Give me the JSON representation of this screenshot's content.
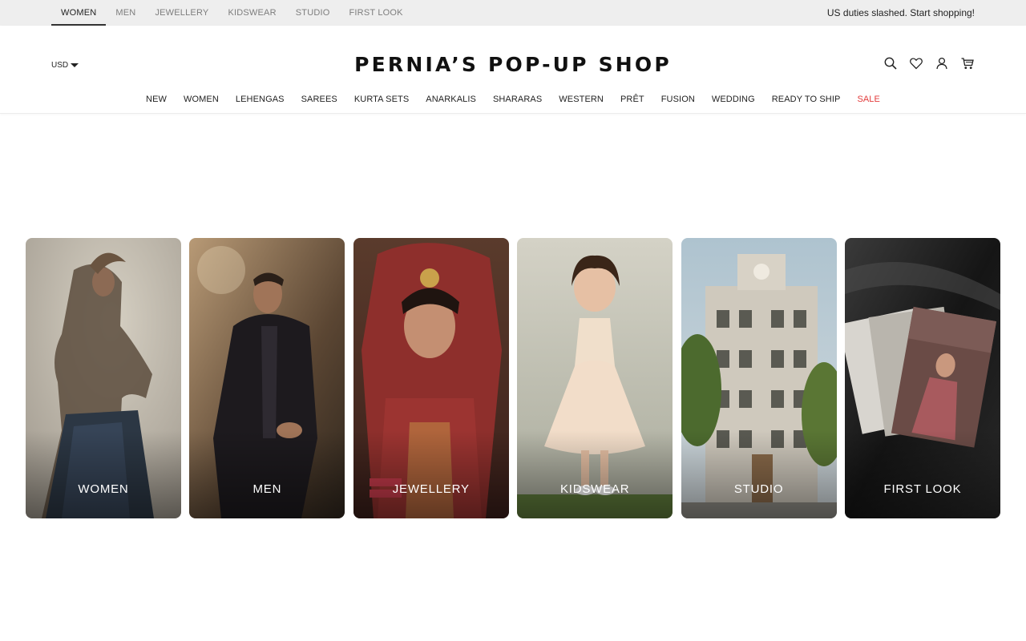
{
  "topbar": {
    "tabs": [
      {
        "label": "WOMEN",
        "active": true
      },
      {
        "label": "MEN",
        "active": false
      },
      {
        "label": "JEWELLERY",
        "active": false
      },
      {
        "label": "KIDSWEAR",
        "active": false
      },
      {
        "label": "STUDIO",
        "active": false
      },
      {
        "label": "FIRST LOOK",
        "active": false
      }
    ],
    "promo": "US duties slashed. Start shopping!"
  },
  "header": {
    "currency": "USD",
    "logo": "PERNIA’S POP-UP SHOP",
    "icons": [
      "search-icon",
      "wishlist-icon",
      "account-icon",
      "cart-icon"
    ]
  },
  "nav": {
    "items": [
      "NEW",
      "WOMEN",
      "LEHENGAS",
      "SAREES",
      "KURTA SETS",
      "ANARKALIS",
      "SHARARAS",
      "WESTERN",
      "PRÊT",
      "FUSION",
      "WEDDING",
      "READY TO SHIP",
      "SALE"
    ],
    "sale_color": "#e23b3b"
  },
  "categories": [
    {
      "label": "WOMEN"
    },
    {
      "label": "MEN"
    },
    {
      "label": "JEWELLERY"
    },
    {
      "label": "KIDSWEAR"
    },
    {
      "label": "STUDIO"
    },
    {
      "label": "FIRST LOOK"
    }
  ]
}
